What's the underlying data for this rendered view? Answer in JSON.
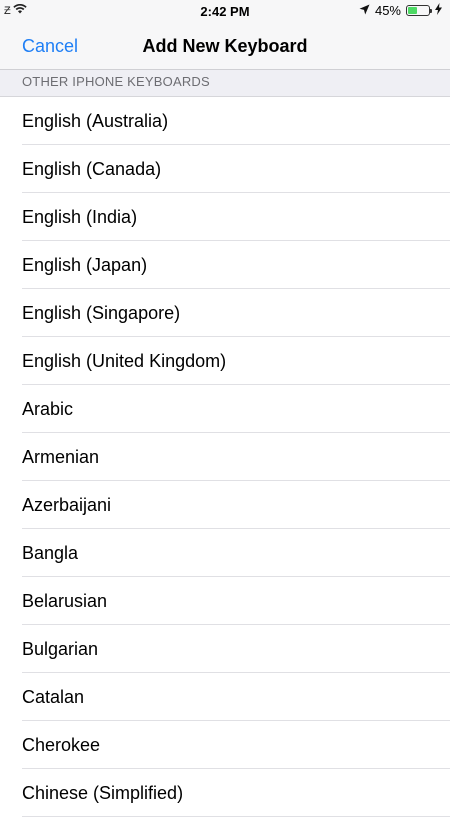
{
  "status_bar": {
    "left_text": "Ƶ",
    "time": "2:42 PM",
    "battery_percent": "45%",
    "battery_level": 0.45,
    "icons": [
      "wifi-icon",
      "location-arrow-icon",
      "battery-icon",
      "charging-bolt-icon"
    ]
  },
  "nav": {
    "cancel_label": "Cancel",
    "title": "Add New Keyboard"
  },
  "section": {
    "header": "OTHER IPHONE KEYBOARDS"
  },
  "keyboards": [
    "English (Australia)",
    "English (Canada)",
    "English (India)",
    "English (Japan)",
    "English (Singapore)",
    "English (United Kingdom)",
    "Arabic",
    "Armenian",
    "Azerbaijani",
    "Bangla",
    "Belarusian",
    "Bulgarian",
    "Catalan",
    "Cherokee",
    "Chinese (Simplified)"
  ],
  "colors": {
    "accent": "#1f7ff5",
    "battery": "#4cd964",
    "header_bg": "#efeff4"
  }
}
